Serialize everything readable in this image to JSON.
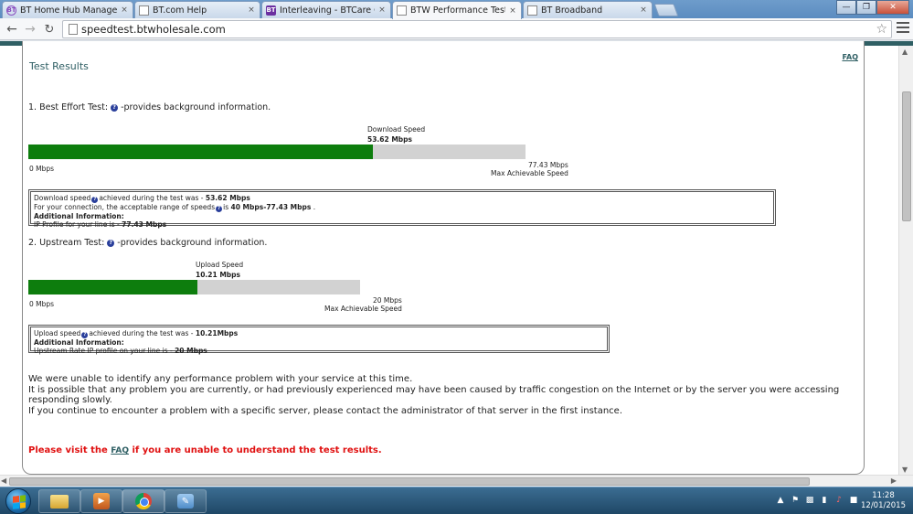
{
  "browser": {
    "tabs": [
      {
        "title": "BT Home Hub Manager -",
        "icon": "bt-circle-icon"
      },
      {
        "title": "BT.com Help",
        "icon": "page-icon"
      },
      {
        "title": "Interleaving - BTCare Com",
        "icon": "bt-logo-icon"
      },
      {
        "title": "BTW Performance Test",
        "icon": "page-icon"
      },
      {
        "title": "BT Broadband",
        "icon": "page-icon"
      }
    ],
    "fav_bt": "BT",
    "close_glyph": "×",
    "url": "speedtest.btwholesale.com"
  },
  "page": {
    "faq_link": "FAQ",
    "title": "Test Results",
    "best_effort": {
      "heading": "1. Best Effort Test:",
      "heading_suffix": "-provides background information.",
      "speed_label": "Download Speed",
      "speed_value": "53.62 Mbps",
      "fill_fraction": 0.6925,
      "min_label": "0 Mbps",
      "max_value": "77.43 Mbps",
      "max_label": "Max Achievable Speed",
      "info": {
        "line1_pre": "Download speed",
        "line1_mid": "achieved during the test was - ",
        "line1_val": "53.62 Mbps",
        "line2_pre": "For your connection, the acceptable range of speeds",
        "line2_mid": "is ",
        "line2_val": "40 Mbps-77.43 Mbps",
        "line2_end": " .",
        "line3": "Additional Information:",
        "line4_pre": "IP Profile for your line is - ",
        "line4_val": "77.43 Mbps"
      }
    },
    "upstream": {
      "heading": "2. Upstream Test:",
      "heading_suffix": "-provides background information.",
      "speed_label": "Upload Speed",
      "speed_value": "10.21 Mbps",
      "fill_fraction": 0.5105,
      "min_label": "0 Mbps",
      "max_value": "20 Mbps",
      "max_label": "Max Achievable Speed",
      "info": {
        "line1_pre": "Upload speed",
        "line1_mid": "achieved during the test was - ",
        "line1_val": "10.21Mbps",
        "line2": "Additional Information:",
        "line3_pre": "Upstream Rate IP profile on your line is - ",
        "line3_val": "20 Mbps"
      }
    },
    "message_1": "We were unable to identify any performance problem with your service at this time.",
    "message_2": "It is possible that any problem you are currently, or had previously experienced may have been caused by traffic congestion on the Internet or by the server you were accessing responding slowly.",
    "message_3": "If you continue to encounter a problem with a specific server, please contact the administrator of that server in the first instance.",
    "visit_pre": "Please visit the ",
    "visit_link": "FAQ",
    "visit_post": " if you are unable to understand the test results."
  },
  "taskbar": {
    "time": "11:28",
    "date": "12/01/2015"
  },
  "colors": {
    "brand_teal": "#2f5f64",
    "bar_green": "#0d7d0d",
    "bar_grey": "#d2d2d2",
    "alert_red": "#e01010"
  }
}
